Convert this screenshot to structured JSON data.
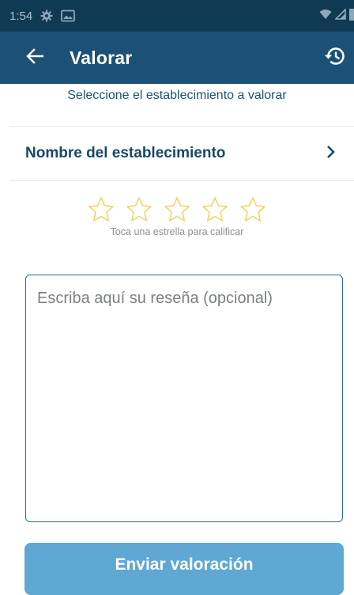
{
  "status_bar": {
    "time": "1:54"
  },
  "app_bar": {
    "title": "Valorar"
  },
  "subtitle": "Seleccione el establecimiento a valorar",
  "establishment": {
    "label": "Nombre del establecimiento"
  },
  "rating": {
    "max_stars": 5,
    "value": 0,
    "hint": "Toca una estrella para calificar"
  },
  "review": {
    "placeholder": "Escriba aquí su reseña (opcional)",
    "value": ""
  },
  "submit": {
    "label": "Enviar valoración"
  },
  "colors": {
    "app_bar": "#1c5175",
    "status_bar": "#0f3a52",
    "star": "#f2d46b",
    "button": "#5fa8d3"
  }
}
